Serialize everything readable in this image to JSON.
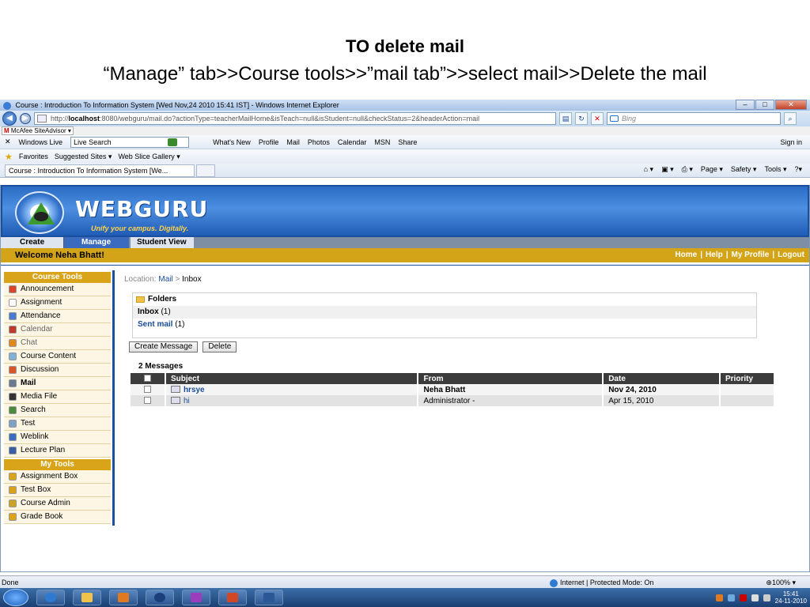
{
  "slide": {
    "title": "TO delete mail",
    "subtitle": "“Manage” tab>>Course tools>>”mail tab”>>select mail>>Delete the mail"
  },
  "window": {
    "title": "Course : Introduction To Information System [Wed Nov,24 2010 15:41 IST] - Windows Internet Explorer",
    "url_prefix": "http://",
    "url_host": "localhost",
    "url_rest": ":8080/webguru/mail.do?actionType=teacherMailHome&isTeach=null&isStudent=null&checkStatus=2&headerAction=mail",
    "search_placeholder": "Bing"
  },
  "mcafee": {
    "label": "McAfee SiteAdvisor ▾"
  },
  "live_toolbar": {
    "close": "✕",
    "brand": "Windows Live",
    "search_value": "Live Search",
    "links": [
      "What's New",
      "Profile",
      "Mail",
      "Photos",
      "Calendar",
      "MSN",
      "Share"
    ],
    "signin": "Sign in"
  },
  "favorites": {
    "label": "Favorites",
    "items": [
      "Suggested Sites ▾",
      "Web Slice Gallery ▾"
    ]
  },
  "tab": {
    "label": "Course : Introduction To Information System [We..."
  },
  "commandbar": [
    "Page ▾",
    "Safety ▾",
    "Tools ▾",
    "?▾"
  ],
  "app": {
    "brand": "WEBGURU",
    "tagline": "Unify your campus. Digitally.",
    "main_tabs": [
      "Create",
      "Manage",
      "Student View"
    ],
    "welcome": "Welcome Neha Bhatt!",
    "top_links": [
      "Home",
      "Help",
      "My Profile",
      "Logout"
    ]
  },
  "sidebar": {
    "course_tools_title": "Course Tools",
    "course_tools": [
      {
        "label": "Announcement",
        "color": "#d9452b"
      },
      {
        "label": "Assignment",
        "color": "#ffffff"
      },
      {
        "label": "Attendance",
        "color": "#4a7bd0"
      },
      {
        "label": "Calendar",
        "color": "#c0392b"
      },
      {
        "label": "Chat",
        "color": "#e08a1e"
      },
      {
        "label": "Course Content",
        "color": "#7fb0d8"
      },
      {
        "label": "Discussion",
        "color": "#d8572a"
      },
      {
        "label": "Mail",
        "color": "#6b7b8f"
      },
      {
        "label": "Media File",
        "color": "#333333"
      },
      {
        "label": "Search",
        "color": "#4a8a3a"
      },
      {
        "label": "Test",
        "color": "#7fa2c8"
      },
      {
        "label": "Weblink",
        "color": "#3a6bbf"
      },
      {
        "label": "Lecture Plan",
        "color": "#3a5fa8"
      }
    ],
    "my_tools_title": "My Tools",
    "my_tools": [
      {
        "label": "Assignment Box",
        "color": "#d9a419"
      },
      {
        "label": "Test Box",
        "color": "#d9a419"
      },
      {
        "label": "Course Admin",
        "color": "#c9a227"
      },
      {
        "label": "Grade Book",
        "color": "#d9a419"
      }
    ]
  },
  "main": {
    "location_label": "Location:",
    "location_link": "Mail",
    "location_sep": ">",
    "location_current": "Inbox",
    "folders_title": "Folders",
    "inbox_label": "Inbox",
    "inbox_count": "(1)",
    "sent_label": "Sent mail",
    "sent_count": "(1)",
    "create_button": "Create Message",
    "delete_button": "Delete",
    "message_count": "2 Messages",
    "columns": [
      "Subject",
      "From",
      "Date",
      "Priority"
    ],
    "messages": [
      {
        "subject": "hrsye",
        "from": "Neha Bhatt",
        "date": "Nov 24, 2010",
        "priority": ""
      },
      {
        "subject": "hi",
        "from": "Administrator -",
        "date": "Apr 15, 2010",
        "priority": ""
      }
    ]
  },
  "status": {
    "left": "Done",
    "zone": "Internet | Protected Mode: On",
    "zoom": "⊕100% ▾"
  },
  "taskbar": {
    "time": "15:41",
    "date": "24-11-2010"
  }
}
